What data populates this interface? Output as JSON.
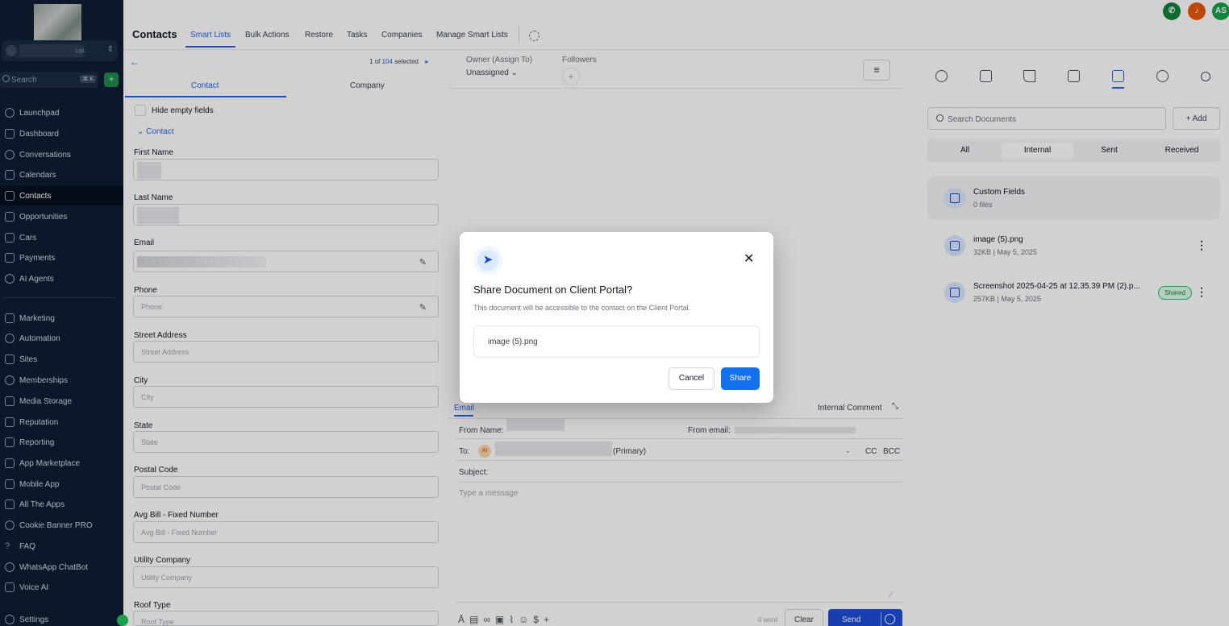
{
  "sidebar": {
    "account_text": "Lijs...",
    "search_placeholder": "Search",
    "search_shortcut": "⌘ K",
    "quick_action": "+",
    "items": [
      {
        "label": "Launchpad"
      },
      {
        "label": "Dashboard"
      },
      {
        "label": "Conversations"
      },
      {
        "label": "Calendars"
      },
      {
        "label": "Contacts"
      },
      {
        "label": "Opportunities"
      },
      {
        "label": "Cars"
      },
      {
        "label": "Payments"
      },
      {
        "label": "AI Agents"
      },
      {
        "label": "Marketing"
      },
      {
        "label": "Automation"
      },
      {
        "label": "Sites"
      },
      {
        "label": "Memberships"
      },
      {
        "label": "Media Storage"
      },
      {
        "label": "Reputation"
      },
      {
        "label": "Reporting"
      },
      {
        "label": "App Marketplace"
      },
      {
        "label": "Mobile App"
      },
      {
        "label": "All The Apps"
      },
      {
        "label": "Cookie Banner PRO"
      },
      {
        "label": "FAQ"
      },
      {
        "label": "WhatsApp ChatBot"
      },
      {
        "label": "Voice AI"
      },
      {
        "label": "Settings"
      }
    ],
    "active_item": "Contacts"
  },
  "header": {
    "title": "Contacts",
    "tabs": [
      {
        "label": "Smart Lists"
      },
      {
        "label": "Bulk Actions"
      },
      {
        "label": "Restore"
      },
      {
        "label": "Tasks"
      },
      {
        "label": "Companies"
      },
      {
        "label": "Manage Smart Lists"
      }
    ],
    "avatar_initials": "AS"
  },
  "contact_panel": {
    "back": "←",
    "pager_prefix": "1 of",
    "pager_count": "104",
    "pager_suffix": "selected",
    "pager_next": "▸",
    "tabs": [
      {
        "label": "Contact"
      },
      {
        "label": "Company"
      }
    ],
    "hide_empty_label": "Hide empty fields",
    "section_label": "Contact",
    "fields": [
      {
        "label": "First Name",
        "placeholder": ""
      },
      {
        "label": "Last Name",
        "placeholder": ""
      },
      {
        "label": "Email",
        "placeholder": ""
      },
      {
        "label": "Phone",
        "placeholder": "Phone"
      },
      {
        "label": "Street Address",
        "placeholder": "Street Address"
      },
      {
        "label": "City",
        "placeholder": "City"
      },
      {
        "label": "State",
        "placeholder": "State"
      },
      {
        "label": "Postal Code",
        "placeholder": "Postal Code"
      },
      {
        "label": "Avg Bill - Fixed Number",
        "placeholder": "Avg Bill - Fixed Number"
      },
      {
        "label": "Utility Company",
        "placeholder": "Utility Company"
      },
      {
        "label": "Roof Type",
        "placeholder": "Roof Type"
      }
    ]
  },
  "conversation": {
    "owner_label": "Owner (Assign To)",
    "owner_value": "Unassigned",
    "followers_label": "Followers",
    "composer": {
      "tab_email": "Email",
      "tab_internal": "Internal Comment",
      "from_name_label": "From Name:",
      "from_email_label": "From email:",
      "to_label": "To:",
      "to_avatar": "AI",
      "to_suffix": "(Primary)",
      "cc": "CC",
      "bcc": "BCC",
      "subject_label": "Subject:",
      "message_placeholder": "Type a message",
      "word_count": "0 word",
      "clear": "Clear",
      "send": "Send"
    }
  },
  "documents": {
    "search_placeholder": "Search Documents",
    "add_label": "+ Add",
    "filters": [
      {
        "label": "All"
      },
      {
        "label": "Internal"
      },
      {
        "label": "Sent"
      },
      {
        "label": "Received"
      }
    ],
    "active_filter": "Internal",
    "folder": {
      "name": "Custom Fields",
      "meta": "0 files"
    },
    "files": [
      {
        "name": "image (5).png",
        "meta": "32KB | May 5, 2025",
        "badge": ""
      },
      {
        "name": "Screenshot 2025-04-25 at 12.35.39 PM (2).p...",
        "meta": "257KB | May 5, 2025",
        "badge": "Shared"
      }
    ]
  },
  "modal": {
    "title": "Share Document on Client Portal?",
    "description": "This document will be accessible to the contact on the Client Portal.",
    "file_name": "image (5).png",
    "cancel": "Cancel",
    "share": "Share"
  },
  "colors": {
    "sidebar_bg": "#0f1e33",
    "accent": "#2563eb",
    "share_button": "#1570ef",
    "phone_circle": "#15803d",
    "bell_circle": "#ea580c",
    "avatar_circle": "#16a34a"
  }
}
